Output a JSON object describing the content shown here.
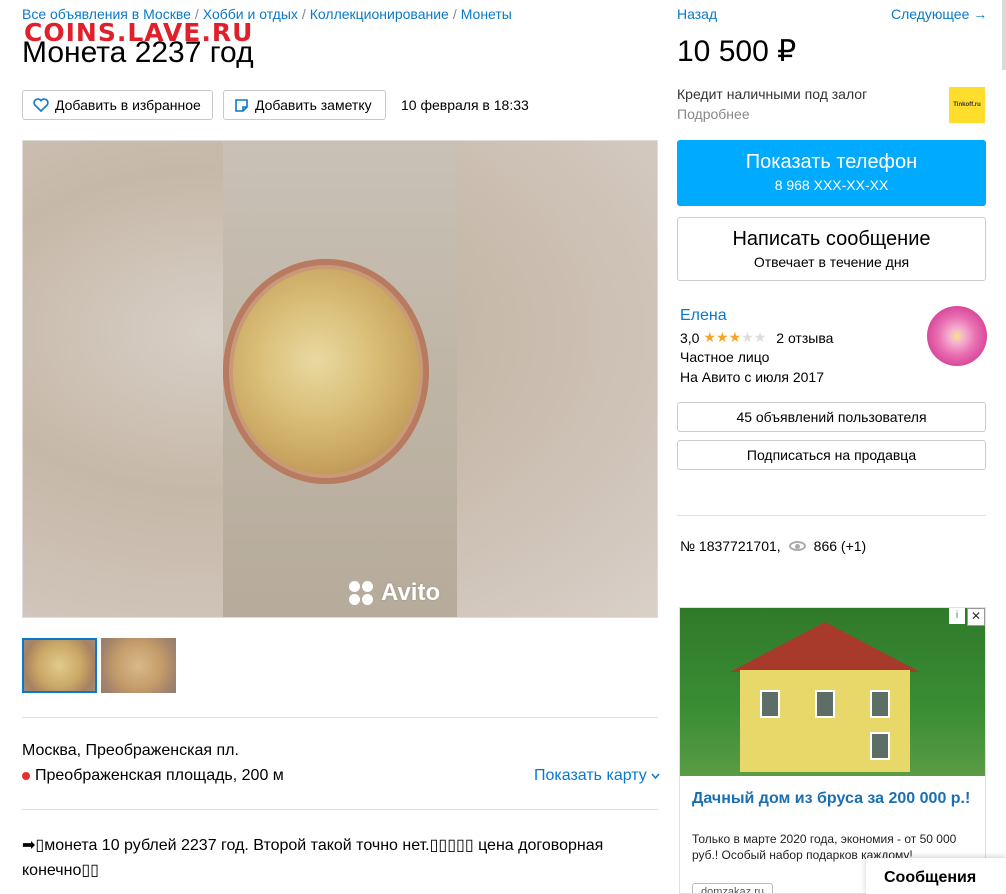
{
  "breadcrumb": {
    "items": [
      "Все объявления в Москве",
      "Хобби и отдых",
      "Коллекционирование",
      "Монеты"
    ],
    "separator": "/"
  },
  "watermark": "COINS.LAVE.RU",
  "listing": {
    "title": "Монета 2237 год",
    "favorite_label": "Добавить в избранное",
    "note_label": "Добавить заметку",
    "date": "10 февраля в 18:33",
    "photo_watermark": "Avito",
    "address": "Москва, Преображенская пл.",
    "metro": "Преображенская площадь, 200 м",
    "show_map": "Показать карту",
    "description": "➡▯монета 10 рублей 2237 год. Второй такой точно нет.▯▯▯▯▯ цена договорная конечно▯▯"
  },
  "nav": {
    "back": "Назад",
    "next": "Следующее →"
  },
  "price": "10 500 ₽",
  "credit": {
    "text": "Кредит наличными под залог",
    "more": "Подробнее",
    "logo": "Tinkoff.ru"
  },
  "contact": {
    "phone_title": "Показать телефон",
    "phone_number": "8 968 XXX-XX-XX",
    "message_title": "Написать сообщение",
    "message_sub": "Отвечает в течение дня"
  },
  "seller": {
    "name": "Елена",
    "rating": "3,0",
    "rating_value": 3,
    "rating_max": 5,
    "reviews": "2 отзыва",
    "type": "Частное лицо",
    "since": "На Авито с июля 2017",
    "ads_button": "45 объявлений пользователя",
    "subscribe_button": "Подписаться на продавца"
  },
  "stats": {
    "item_number": "№ 1837721701,",
    "views": "866 (+1)"
  },
  "ad": {
    "title": "Дачный дом из бруса за 200 000 р.!",
    "text": "Только в марте 2020 года, экономия - от 50 000 руб.! Особый набор подарков каждому!",
    "link": "domzakaz.ru",
    "close": "✕",
    "info": "i"
  },
  "messages_label": "Сообщения",
  "colors": {
    "link": "#0a79c9",
    "phone_button": "#00aaff",
    "star": "#f5a623",
    "metro_dot": "#e4312b"
  }
}
